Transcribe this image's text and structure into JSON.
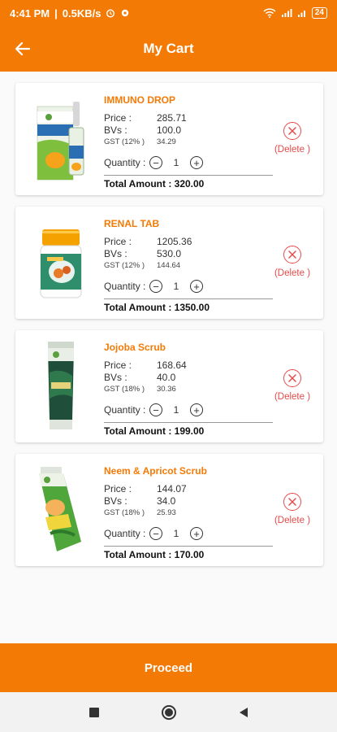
{
  "status_bar": {
    "time": "4:41 PM",
    "speed": "0.5KB/s",
    "battery": "24"
  },
  "header": {
    "title": "My Cart"
  },
  "labels": {
    "price": "Price :",
    "bvs": "BVs :",
    "quantity": "Quantity :",
    "minus": "−",
    "plus": "+",
    "delete": "(Delete )"
  },
  "items": [
    {
      "name": "IMMUNO DROP",
      "price": "285.71",
      "bvs": "100.0",
      "gst_label": "GST (12% )",
      "gst": "34.29",
      "quantity": "1",
      "total": "Total Amount : 320.00",
      "image_icon": "dropper-bottle-box"
    },
    {
      "name": "RENAL TAB",
      "price": "1205.36",
      "bvs": "530.0",
      "gst_label": "GST (12% )",
      "gst": "144.64",
      "quantity": "1",
      "total": "Total Amount : 1350.00",
      "image_icon": "pill-jar"
    },
    {
      "name": "Jojoba Scrub",
      "price": "168.64",
      "bvs": "40.0",
      "gst_label": "GST (18% )",
      "gst": "30.36",
      "quantity": "1",
      "total": "Total Amount : 199.00",
      "image_icon": "dark-tube"
    },
    {
      "name": "Neem & Apricot Scrub",
      "price": "144.07",
      "bvs": "34.0",
      "gst_label": "GST (18% )",
      "gst": "25.93",
      "quantity": "1",
      "total": "Total Amount : 170.00",
      "image_icon": "green-tube"
    }
  ],
  "footer": {
    "proceed_label": "Proceed"
  },
  "colors": {
    "accent": "#f47a06",
    "delete": "#e44b4b"
  }
}
